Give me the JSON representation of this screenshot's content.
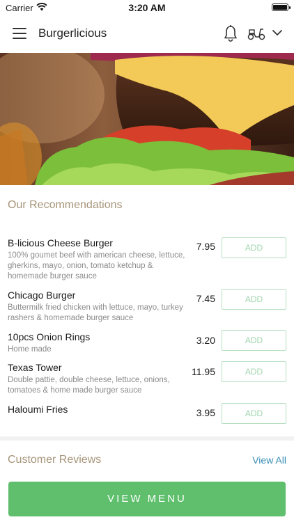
{
  "status_bar": {
    "carrier": "Carrier",
    "time": "3:20 AM"
  },
  "nav": {
    "title": "Burgerlicious",
    "icons": [
      "menu-icon",
      "bell-icon",
      "scooter-icon",
      "chevron-down-icon"
    ]
  },
  "hero": {
    "image": "burger-photo"
  },
  "recommendations": {
    "title": "Our Recommendations",
    "add_label": "ADD",
    "items": [
      {
        "name": "B-licious Cheese Burger",
        "description": "100% goumet beef with american cheese, lettuce, gherkins, mayo, onion, tomato ketchup & homemade burger sauce",
        "price": "7.95"
      },
      {
        "name": "Chicago Burger",
        "description": "Buttermilk fried chicken with lettuce, mayo, turkey rashers & homemade burger sauce",
        "price": "7.45"
      },
      {
        "name": "10pcs Onion Rings",
        "description": "Home made",
        "price": "3.20"
      },
      {
        "name": "Texas Tower",
        "description": "Double pattie, double cheese, lettuce, onions, tomatoes & home made burger sauce",
        "price": "11.95"
      },
      {
        "name": "Haloumi Fries",
        "description": "",
        "price": "3.95"
      }
    ]
  },
  "reviews": {
    "title": "Customer Reviews",
    "view_all": "View All"
  },
  "footer": {
    "button": "VIEW MENU"
  },
  "colors": {
    "accent_green": "#5fbf6d",
    "section_title": "#a69479",
    "link_blue": "#3a8fb7"
  }
}
